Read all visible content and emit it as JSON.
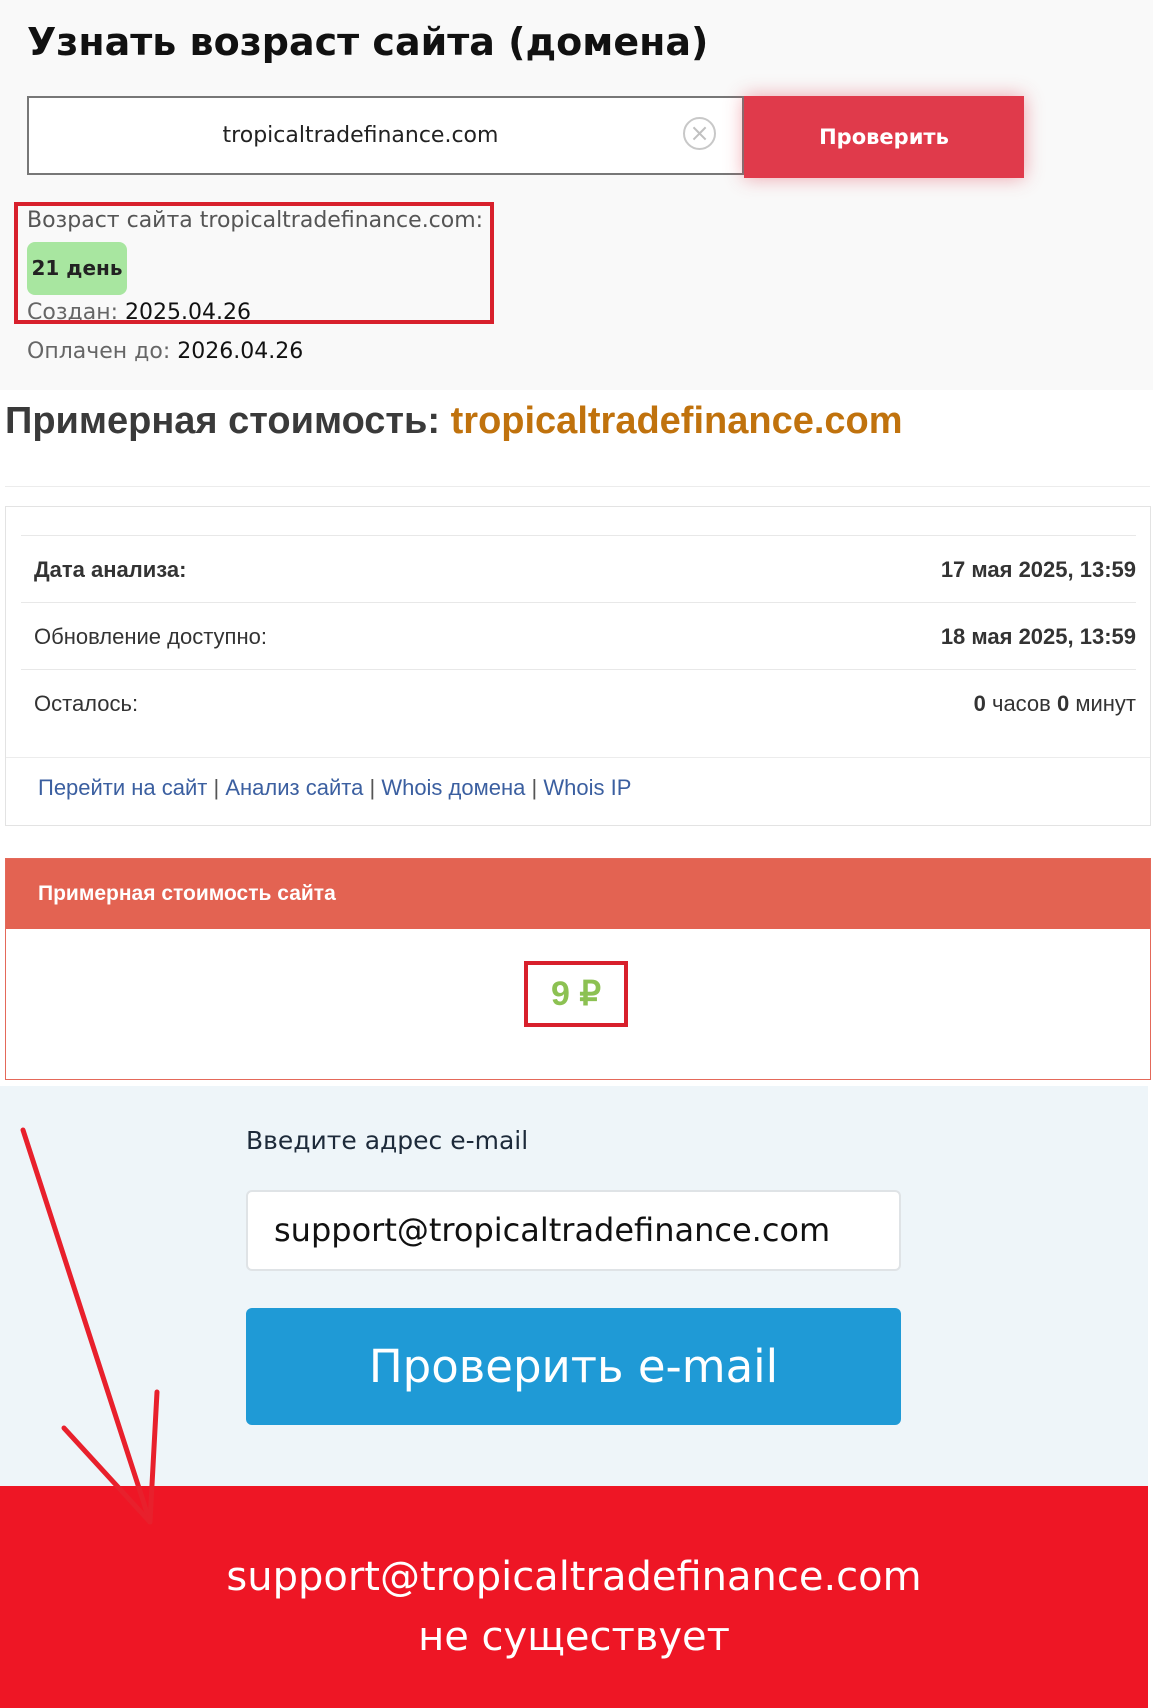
{
  "age_check": {
    "title": "Узнать возраст сайта (домена)",
    "domain_value": "tropicaltradefinance.com",
    "clear_symbol": "×",
    "check_button_label": "Проверить",
    "result_label": "Возраст сайта tropicaltradefinance.com:",
    "age_badge": "21 день",
    "created_label": "Создан:",
    "created_value": "2025.04.26",
    "paid_label": "Оплачен до:",
    "paid_value": "2026.04.26",
    "badge_color": "#a8e6a0",
    "button_color": "#e03a4b"
  },
  "cost": {
    "title_prefix": "Примерная стоимость:",
    "title_domain": "tropicaltradefinance.com",
    "rows": [
      {
        "label": "Дата анализа:",
        "value": "17 мая 2025, 13:59"
      },
      {
        "label": "Обновление доступно:",
        "value": "18 мая 2025, 13:59"
      },
      {
        "label": "Осталось:",
        "hours": "0",
        "hours_unit": "часов",
        "minutes": "0",
        "minutes_unit": "минут"
      }
    ],
    "links": [
      "Перейти на сайт",
      "Анализ сайта",
      "Whois домена",
      "Whois IP"
    ],
    "link_separator": "|",
    "price_header": "Примерная стоимость сайта",
    "price_value": "9 ₽",
    "price_color": "#8cc152",
    "header_color": "#e36352"
  },
  "email_check": {
    "label": "Введите адрес e-mail",
    "email_value": "support@tropicaltradefinance.com",
    "button_label": "Проверить e-mail",
    "button_color": "#1f9ad6"
  },
  "result": {
    "email": "support@tropicaltradefinance.com",
    "status": "не существует",
    "banner_color": "#ee1625"
  }
}
